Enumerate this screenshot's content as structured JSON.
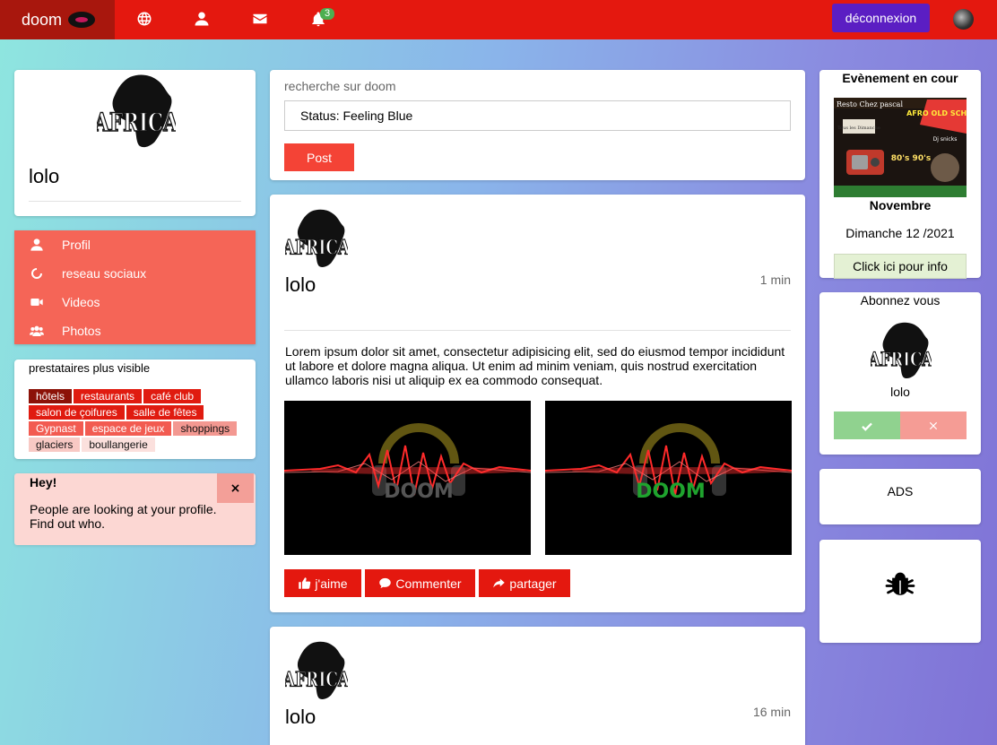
{
  "topbar": {
    "brand": "doom",
    "notification_count": "3",
    "logout_label": "déconnexion",
    "icons": [
      "globe-icon",
      "user-icon",
      "envelope-icon",
      "bell-icon"
    ]
  },
  "profile": {
    "name": "lolo",
    "logo_text": "AFRICA"
  },
  "menu": {
    "items": [
      {
        "label": "Profil",
        "icon": "user-icon"
      },
      {
        "label": "reseau sociaux",
        "icon": "circle-notch-icon"
      },
      {
        "label": "Videos",
        "icon": "video-icon"
      },
      {
        "label": "Photos",
        "icon": "users-icon"
      }
    ]
  },
  "providers": {
    "title": "prestataires plus visible",
    "tags": [
      "hôtels",
      "restaurants",
      "café club",
      "salon de çoifures",
      "salle de fêtes",
      "Gypnast",
      "espace de jeux",
      "shoppings",
      "glaciers",
      "boullangerie"
    ]
  },
  "alert": {
    "title": "Hey!",
    "close_label": "×",
    "text": "People are looking at your profile. Find out who."
  },
  "composer": {
    "search_label": "recherche sur doom",
    "status_value": "Status: Feeling Blue",
    "post_label": "Post"
  },
  "posts": [
    {
      "author": "lolo",
      "time": "1 min",
      "text": "Lorem ipsum dolor sit amet, consectetur adipisicing elit, sed do eiusmod tempor incididunt ut labore et dolore magna aliqua. Ut enim ad minim veniam, quis nostrud exercitation ullamco laboris nisi ut aliquip ex ea commodo consequat.",
      "image_texts": [
        "DOOM",
        "DOOM"
      ],
      "actions": {
        "like": "j'aime",
        "comment": "Commenter",
        "share": "partager"
      }
    },
    {
      "author": "lolo",
      "time": "16 min"
    }
  ],
  "event": {
    "title": "Evènement en cour",
    "poster_venue": "Resto Chez pascal",
    "poster_tag": "Tous les Dimanche",
    "poster_headline": "AFRO OLD SCHOOL",
    "poster_years": "80's 90's",
    "poster_dj": "Dj snicks",
    "month": "Novembre",
    "date": "Dimanche 12 /2021",
    "info_label": "Click ici pour info"
  },
  "subscribe": {
    "title": "Abonnez vous",
    "name": "lolo"
  },
  "ads": {
    "label": "ADS"
  },
  "colors": {
    "topbar": "#e4180f",
    "brand_bg": "#a8170d",
    "logout": "#5b1ec3",
    "menu": "#f56557",
    "alert": "#fcd7d3",
    "action": "#e4180f",
    "accept": "#90d28f",
    "reject": "#f59c95"
  }
}
